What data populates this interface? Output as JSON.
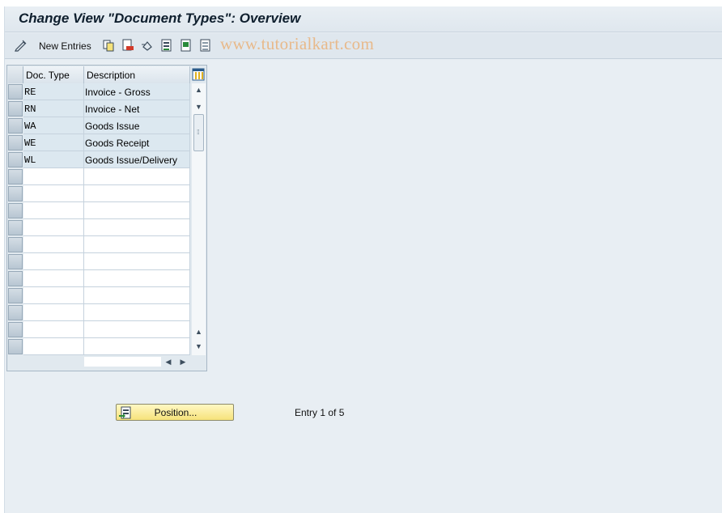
{
  "title": "Change View \"Document Types\": Overview",
  "toolbar": {
    "new_entries_label": "New Entries",
    "icons": [
      "edit-pencil-icon",
      "copy-icon",
      "delete-icon",
      "undo-icon",
      "select-all-icon",
      "select-block-icon",
      "deselect-all-icon"
    ]
  },
  "watermark": "www.tutorialkart.com",
  "table": {
    "columns": [
      "Doc. Type",
      "Description"
    ],
    "rows": [
      {
        "type": "RE",
        "desc": "Invoice - Gross"
      },
      {
        "type": "RN",
        "desc": "Invoice - Net"
      },
      {
        "type": "WA",
        "desc": "Goods Issue"
      },
      {
        "type": "WE",
        "desc": "Goods Receipt"
      },
      {
        "type": "WL",
        "desc": "Goods Issue/Delivery"
      }
    ],
    "empty_rows": 11
  },
  "position_button": {
    "label": "Position..."
  },
  "entry_status": "Entry 1 of 5",
  "colors": {
    "button_yellow": "#f6e27a",
    "background": "#e8eef3",
    "watermark": "#e8b98a"
  }
}
